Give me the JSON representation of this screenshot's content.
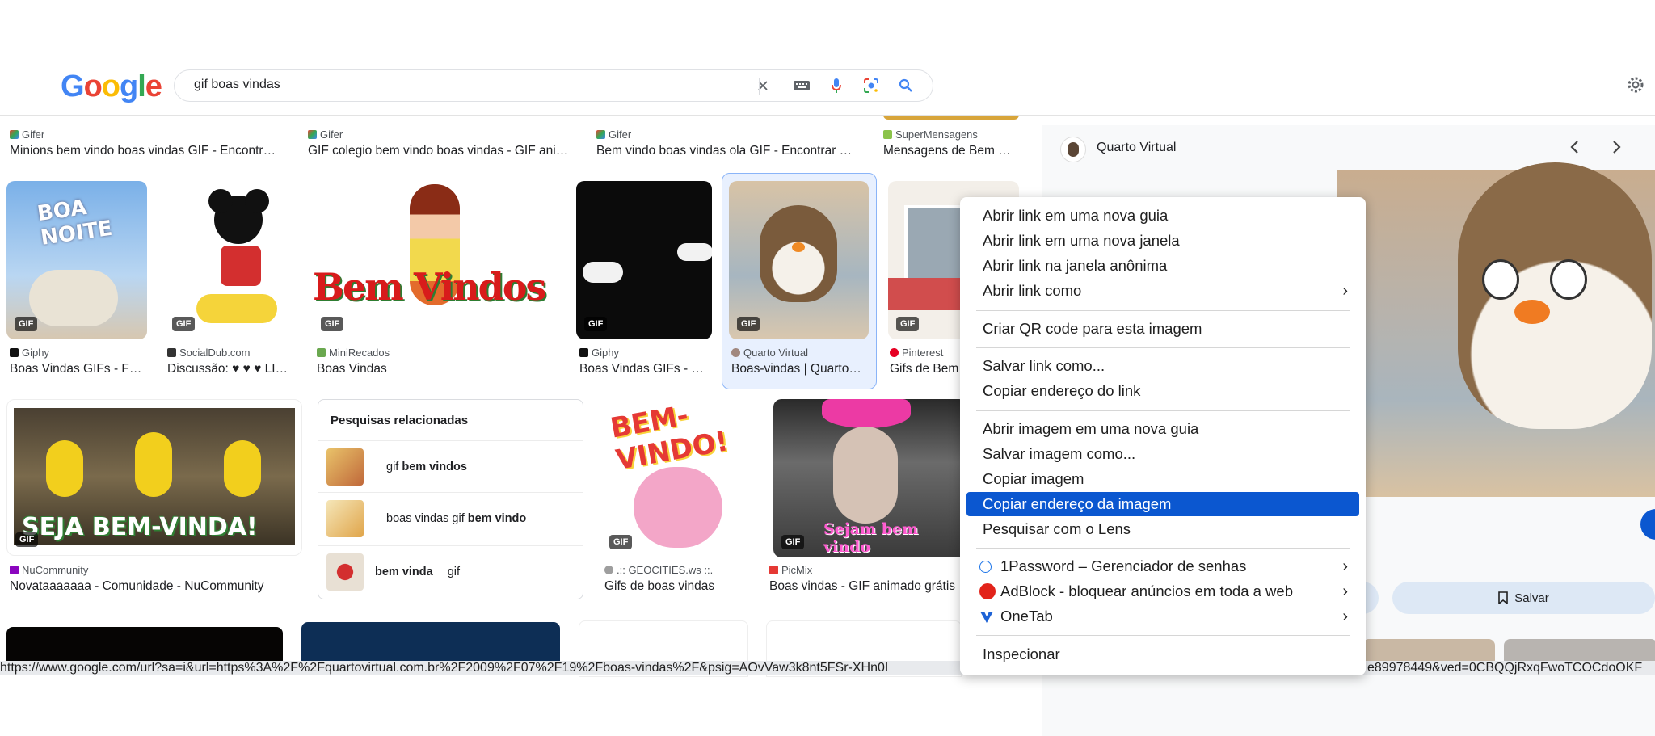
{
  "header": {
    "logo": "Google",
    "query": "gif boas vindas"
  },
  "results_top": [
    {
      "source": "Gifer",
      "title": "Minions bem vindo boas vindas GIF - Encontr…"
    },
    {
      "source": "Gifer",
      "title": "GIF colegio bem vindo boas vindas - GIF ani…"
    },
    {
      "source": "Gifer",
      "title": "Bem vindo boas vindas ola GIF - Encontrar …"
    },
    {
      "source": "SuperMensagens",
      "title": "Mensagens de Bem …"
    }
  ],
  "results_row2": [
    {
      "source": "Giphy",
      "title": "Boas Vindas GIFs - F…",
      "badge": "GIF"
    },
    {
      "source": "SocialDub.com",
      "title": "Discussão: ♥ ♥ ♥ LI…",
      "badge": "GIF"
    },
    {
      "source": "MiniRecados",
      "title": "Boas Vindas",
      "badge": "GIF"
    },
    {
      "source": "Giphy",
      "title": "Boas Vindas GIFs - …",
      "badge": "GIF"
    },
    {
      "source": "Quarto Virtual",
      "title": "Boas-vindas | Quarto…",
      "badge": "GIF"
    },
    {
      "source": "Pinterest",
      "title": "Gifs de Bem",
      "badge": "GIF"
    }
  ],
  "results_row3": [
    {
      "source": "NuCommunity",
      "title": "Novataaaaaaa - Comunidade - NuCommunity",
      "badge": "GIF",
      "caption": "SEJA BEM-VINDA!"
    },
    {
      "source": ".:: GEOCITIES.ws ::.",
      "title": "Gifs de boas vindas",
      "badge": "GIF",
      "caption": "BEM-VINDO!"
    },
    {
      "source": "PicMix",
      "title": "Boas vindas - GIF animado grátis",
      "badge": "GIF",
      "caption": "Sejam bem vindo"
    }
  ],
  "related": {
    "heading": "Pesquisas relacionadas",
    "items": [
      {
        "normal": "gif ",
        "bold": "bem vindos"
      },
      {
        "normal": "boas vindas gif ",
        "bold": "bem vindo"
      },
      {
        "bold": "bem vinda",
        "normal2": " gif"
      }
    ]
  },
  "panel": {
    "source": "Quarto Virtual",
    "save_label": "Salvar"
  },
  "status_url": "https://www.google.com/url?sa=i&url=https%3A%2F%2Fquartovirtual.com.br%2F2009%2F07%2F19%2Fboas-vindas%2F&psig=AOvVaw3k8nt5FSr-XHn0I",
  "status_url_end": "e89978449&ved=0CBQQjRxqFwoTCOCdoOKF",
  "context_menu": {
    "items": [
      {
        "label": "Abrir link em uma nova guia"
      },
      {
        "label": "Abrir link em uma nova janela"
      },
      {
        "label": "Abrir link na janela anônima"
      },
      {
        "label": "Abrir link como"
      },
      {
        "label": "Criar QR code para esta imagem"
      },
      {
        "label": "Salvar link como..."
      },
      {
        "label": "Copiar endereço do link"
      },
      {
        "label": "Abrir imagem em uma nova guia"
      },
      {
        "label": "Salvar imagem como..."
      },
      {
        "label": "Copiar imagem"
      },
      {
        "label": "Copiar endereço da imagem"
      },
      {
        "label": "Pesquisar com o Lens"
      },
      {
        "label": "1Password – Gerenciador de senhas"
      },
      {
        "label": "AdBlock - bloquear anúncios em toda a web"
      },
      {
        "label": "OneTab"
      },
      {
        "label": "Inspecionar"
      }
    ]
  },
  "colors": {
    "highlight": "#0b57d0",
    "link_source": "#4d5156"
  }
}
